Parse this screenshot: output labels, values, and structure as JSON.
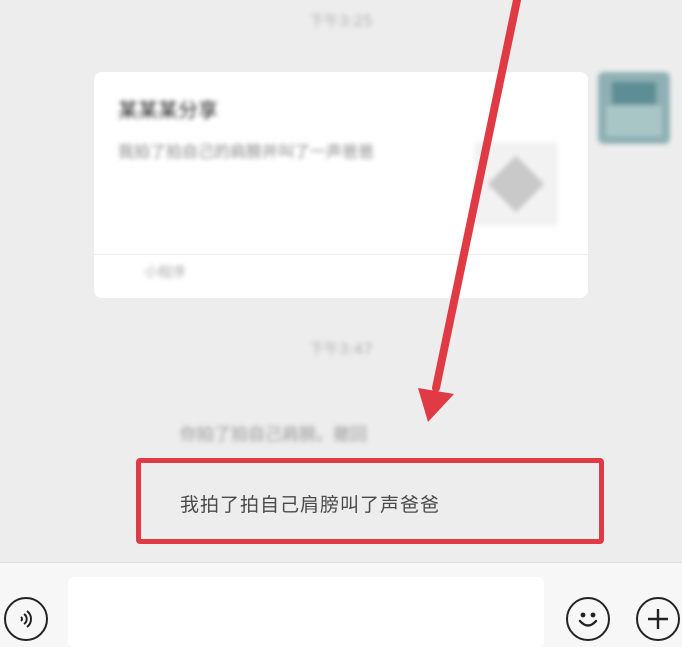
{
  "chat": {
    "timestamp_1": "下午3:25",
    "timestamp_2": "下午3:47",
    "card": {
      "title": "某某某分享",
      "description": "我拍了拍自己的肩膀并叫了一声爸爸",
      "source": "小程序"
    },
    "system_message": "你拍了拍自己肩膀。撤回",
    "pat_text": "我拍了拍自己肩膀叫了声爸爸"
  },
  "input_bar": {
    "placeholder": "",
    "voice_icon": "voice-icon",
    "emoji_icon": "emoji-icon",
    "plus_icon": "plus-icon"
  },
  "colors": {
    "background": "#ededed",
    "highlight": "#e03a45",
    "arrow": "#e03a45"
  }
}
